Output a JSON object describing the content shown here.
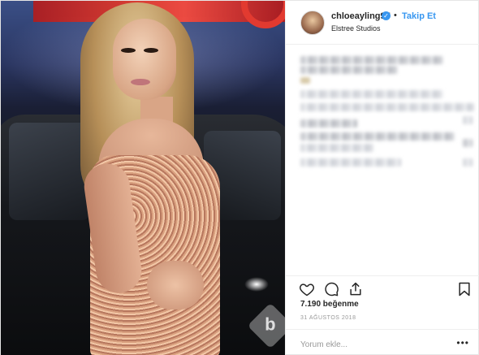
{
  "post": {
    "username": "chloeayling97",
    "follow_label": "Takip Et",
    "separator": "•",
    "location": "Elstree Studios",
    "likes": "7.190 beğenme",
    "date": "31 AĞUSTOS 2018",
    "comment_placeholder": "Yorum ekle...",
    "more_label": "•••"
  },
  "icons": {
    "verified": "verified-badge-icon",
    "like": "heart-icon",
    "comment": "comment-bubble-icon",
    "share": "share-icon",
    "save": "bookmark-icon",
    "watermark": "b"
  },
  "colors": {
    "accent": "#3897f0",
    "text": "#262626",
    "muted": "#999999",
    "border": "#efefef"
  }
}
